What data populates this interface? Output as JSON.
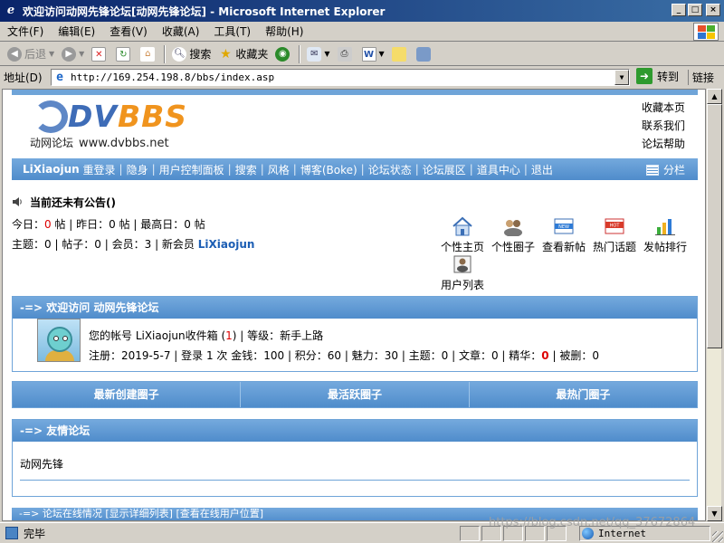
{
  "window": {
    "title": "欢迎访问动网先锋论坛[动网先锋论坛] - Microsoft Internet Explorer",
    "buttons": {
      "minimize": "_",
      "maximize": "□",
      "close": "×"
    }
  },
  "menu": [
    "文件(F)",
    "编辑(E)",
    "查看(V)",
    "收藏(A)",
    "工具(T)",
    "帮助(H)"
  ],
  "toolbar": {
    "back": "后退",
    "search": "搜索",
    "favorites": "收藏夹"
  },
  "address": {
    "label": "地址(D)",
    "url": "http://169.254.198.8/bbs/index.asp",
    "go": "转到",
    "links": "链接"
  },
  "status": {
    "text": "完毕",
    "zone": "Internet",
    "watermark": "https://blog.csdn.net/qq_37672864"
  },
  "page": {
    "logo": {
      "brand_main": "DV",
      "brand_accent": "BBS",
      "subtitle": "动网论坛",
      "site": "www.dvbbs.net"
    },
    "toplinks": [
      "收藏本页",
      "联系我们",
      "论坛帮助"
    ],
    "nav": {
      "user": "LiXiaojun",
      "items": [
        "重登录",
        "隐身",
        "用户控制面板",
        "搜索",
        "风格",
        "博客(Boke)",
        "论坛状态",
        "论坛展区",
        "道具中心",
        "退出"
      ],
      "split": "分栏"
    },
    "notice": "当前还未有公告()",
    "stats": {
      "today_label": "今日：",
      "today": "0",
      "post_unit1": " 帖 | 昨日：",
      "yesterday": "0",
      "post_unit2": " 帖 | 最高日：",
      "max": "0",
      "post_unit3": " 帖",
      "line2_prefix": "主题：0 | 帖子：0 | 会员：3 | 新会员 ",
      "new_member": "LiXiaojun"
    },
    "quick": [
      "个性主页",
      "个性圈子",
      "查看新帖",
      "热门话题",
      "发帖排行",
      "用户列表"
    ],
    "welcome": {
      "header": "-=> 欢迎访问 动网先锋论坛",
      "line1_prefix": "您的帐号 LiXiaojun收件箱 (",
      "inbox": "1",
      "line1_suffix": ") | 等级：新手上路",
      "line2_prefix": "注册：2019-5-7 | 登录 1 次 金钱：100 | 积分：60 | 魅力：30 | 主题：0 | 文章：0 | 精华：",
      "jinghua": "0",
      "line2_suffix": " | 被删：0"
    },
    "circles": [
      "最新创建圈子",
      "最活跃圈子",
      "最热门圈子"
    ],
    "friends": {
      "header": "-=> 友情论坛",
      "item": "动网先锋"
    },
    "bottom_partial": "-=> 论坛在线情况 [显示详细列表] [查看在线用户位置]"
  }
}
